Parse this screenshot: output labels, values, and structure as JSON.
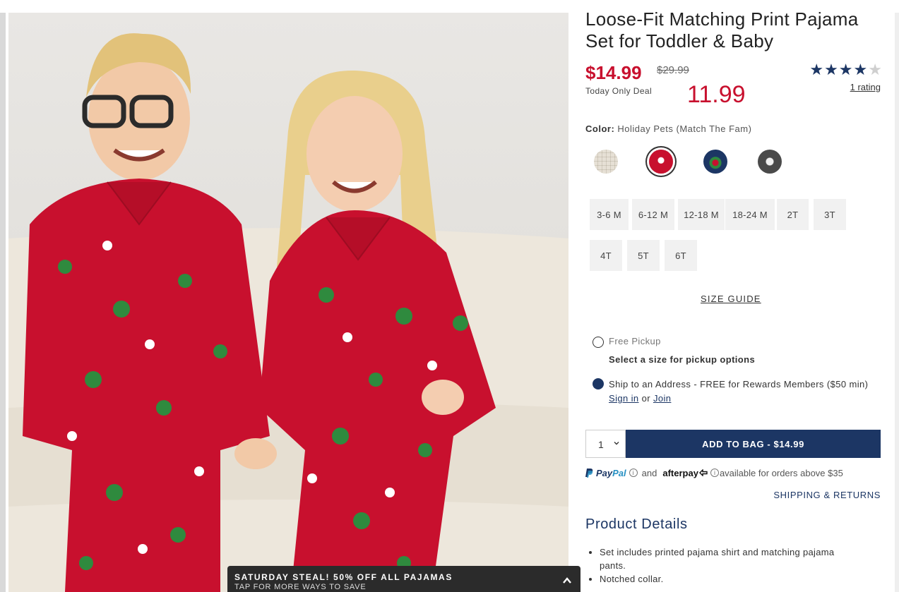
{
  "product": {
    "title": "Loose-Fit Matching Print Pajama Set for Toddler & Baby",
    "price": "$14.99",
    "old_price": "$29.99",
    "deal_text": "Today Only Deal",
    "overlay_price": "11.99",
    "rating": 4,
    "rating_max": 5,
    "rating_link": "1 rating"
  },
  "color": {
    "label": "Color:",
    "value": "Holiday Pets (Match The Fam)",
    "swatches": [
      {
        "name": "plaid-cream",
        "color": "#ece9e2"
      },
      {
        "name": "holiday-pets-red",
        "color": "#c8102e",
        "selected": true
      },
      {
        "name": "navy-holiday",
        "color": "#1c3664"
      },
      {
        "name": "gray-print",
        "color": "#6d6d6d"
      }
    ]
  },
  "sizes": [
    "3-6 M",
    "6-12 M",
    "12-18 M",
    "18-24 M",
    "2T",
    "3T",
    "4T",
    "5T",
    "6T"
  ],
  "size_guide": "SIZE GUIDE",
  "fulfillment": {
    "pickup_label": "Free Pickup",
    "pickup_note": "Select a size for pickup options",
    "ship_label": "Ship to an Address - FREE for Rewards Members ($50 min)",
    "sign_in": "Sign in",
    "or": "or",
    "join": "Join"
  },
  "cart": {
    "qty": "1",
    "add_button": "ADD TO BAG  -  $14.99"
  },
  "payment": {
    "paypal_a": "Pay",
    "paypal_b": "Pal",
    "and": "and",
    "afterpay": "afterpay",
    "note": "available for orders above $35"
  },
  "shipping_link": "SHIPPING & RETURNS",
  "details": {
    "title": "Product Details",
    "items": [
      "Set includes printed pajama shirt and matching pajama pants.",
      "Notched collar."
    ]
  },
  "promo": {
    "line1": "SATURDAY STEAL! 50% OFF ALL PAJAMAS",
    "line2": "TAP FOR MORE WAYS TO SAVE"
  },
  "colors": {
    "accent_red": "#c8102e",
    "navy": "#1c3664"
  }
}
